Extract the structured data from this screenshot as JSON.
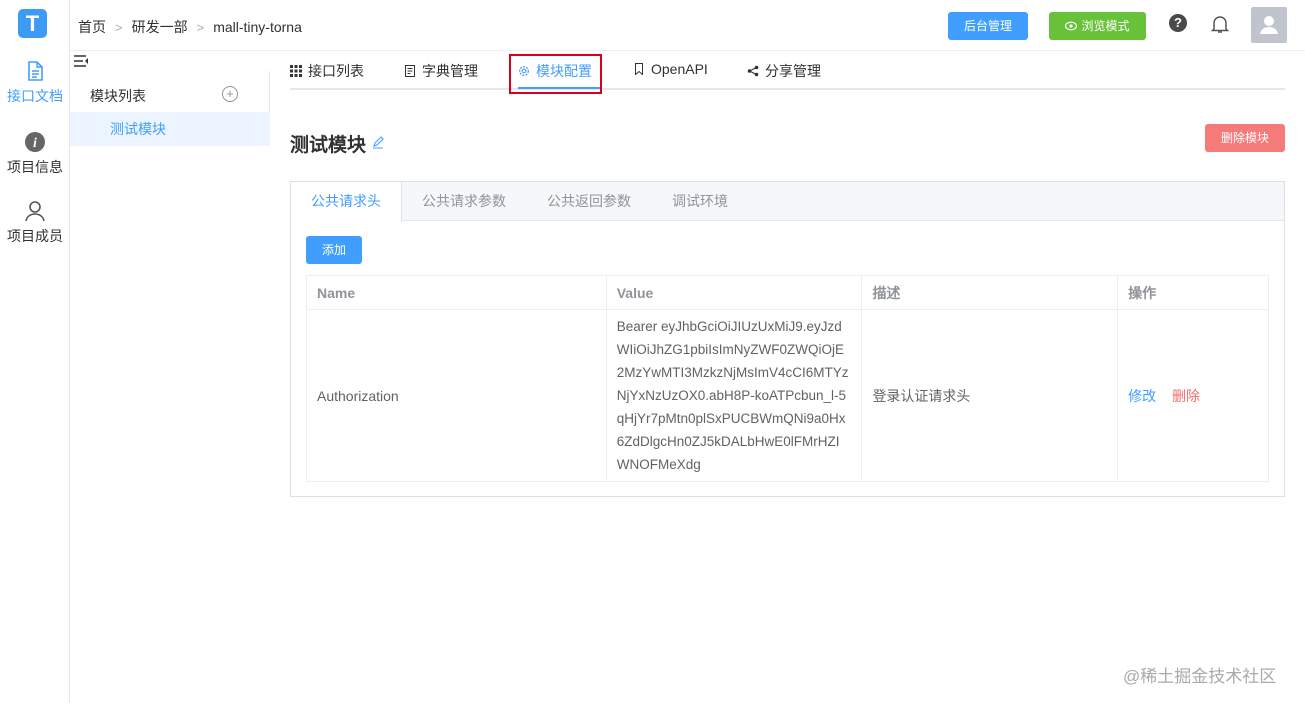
{
  "app": {
    "logo_letter": "T"
  },
  "rail": [
    {
      "label": "接口文档",
      "icon": "document-icon",
      "active": true
    },
    {
      "label": "项目信息",
      "icon": "info-icon",
      "active": false
    },
    {
      "label": "项目成员",
      "icon": "user-icon",
      "active": false
    }
  ],
  "breadcrumb": {
    "items": [
      "首页",
      "研发一部",
      "mall-tiny-torna"
    ],
    "separator": ">"
  },
  "header": {
    "admin_button": "后台管理",
    "browse_button": "浏览模式",
    "help_glyph": "?"
  },
  "module_sidebar": {
    "title": "模块列表",
    "add_glyph": "+",
    "items": [
      "测试模块"
    ]
  },
  "top_tabs": [
    {
      "label": "接口列表",
      "icon": "grid-icon"
    },
    {
      "label": "字典管理",
      "icon": "book-icon"
    },
    {
      "label": "模块配置",
      "icon": "gear-icon",
      "active": true
    },
    {
      "label": "OpenAPI",
      "icon": "bookmark-icon"
    },
    {
      "label": "分享管理",
      "icon": "share-icon"
    }
  ],
  "module": {
    "title": "测试模块",
    "delete_button": "删除模块"
  },
  "config_tabs": [
    "公共请求头",
    "公共请求参数",
    "公共返回参数",
    "调试环境"
  ],
  "add_button": "添加",
  "table": {
    "headers": [
      "Name",
      "Value",
      "描述",
      "操作"
    ],
    "rows": [
      {
        "name": "Authorization",
        "value": "Bearer eyJhbGciOiJIUzUxMiJ9.eyJzdWIiOiJhZG1pbiIsImNyZWF0ZWQiOjE2MzYwMTI3MzkzNjMsImV4cCI6MTYzNjYxNzUzOX0.abH8P-koATPcbun_l-5qHjYr7pMtn0plSxPUCBWmQNi9a0Hx6ZdDlgcHn0ZJ5kDALbHwE0lFMrHZIWNOFMeXdg",
        "description": "登录认证请求头",
        "edit": "修改",
        "delete": "删除"
      }
    ]
  },
  "watermark": "@稀土掘金技术社区",
  "colors": {
    "primary": "#409eff",
    "success": "#67c23a",
    "danger": "#f56c6c",
    "highlight": "#d9001b"
  }
}
